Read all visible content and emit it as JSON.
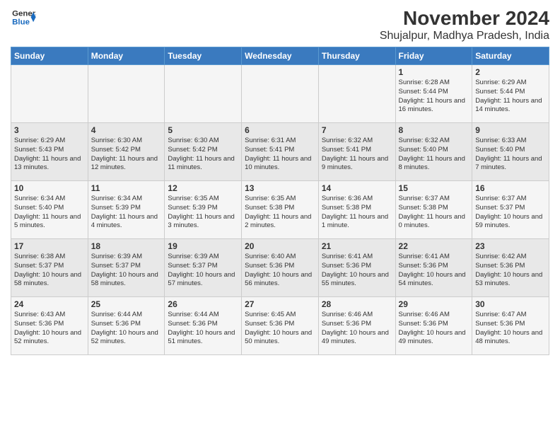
{
  "logo": {
    "line1": "General",
    "line2": "Blue"
  },
  "title": "November 2024",
  "subtitle": "Shujalpur, Madhya Pradesh, India",
  "weekdays": [
    "Sunday",
    "Monday",
    "Tuesday",
    "Wednesday",
    "Thursday",
    "Friday",
    "Saturday"
  ],
  "weeks": [
    [
      {
        "day": "",
        "info": ""
      },
      {
        "day": "",
        "info": ""
      },
      {
        "day": "",
        "info": ""
      },
      {
        "day": "",
        "info": ""
      },
      {
        "day": "",
        "info": ""
      },
      {
        "day": "1",
        "info": "Sunrise: 6:28 AM\nSunset: 5:44 PM\nDaylight: 11 hours\nand 16 minutes."
      },
      {
        "day": "2",
        "info": "Sunrise: 6:29 AM\nSunset: 5:44 PM\nDaylight: 11 hours\nand 14 minutes."
      }
    ],
    [
      {
        "day": "3",
        "info": "Sunrise: 6:29 AM\nSunset: 5:43 PM\nDaylight: 11 hours\nand 13 minutes."
      },
      {
        "day": "4",
        "info": "Sunrise: 6:30 AM\nSunset: 5:42 PM\nDaylight: 11 hours\nand 12 minutes."
      },
      {
        "day": "5",
        "info": "Sunrise: 6:30 AM\nSunset: 5:42 PM\nDaylight: 11 hours\nand 11 minutes."
      },
      {
        "day": "6",
        "info": "Sunrise: 6:31 AM\nSunset: 5:41 PM\nDaylight: 11 hours\nand 10 minutes."
      },
      {
        "day": "7",
        "info": "Sunrise: 6:32 AM\nSunset: 5:41 PM\nDaylight: 11 hours\nand 9 minutes."
      },
      {
        "day": "8",
        "info": "Sunrise: 6:32 AM\nSunset: 5:40 PM\nDaylight: 11 hours\nand 8 minutes."
      },
      {
        "day": "9",
        "info": "Sunrise: 6:33 AM\nSunset: 5:40 PM\nDaylight: 11 hours\nand 7 minutes."
      }
    ],
    [
      {
        "day": "10",
        "info": "Sunrise: 6:34 AM\nSunset: 5:40 PM\nDaylight: 11 hours\nand 5 minutes."
      },
      {
        "day": "11",
        "info": "Sunrise: 6:34 AM\nSunset: 5:39 PM\nDaylight: 11 hours\nand 4 minutes."
      },
      {
        "day": "12",
        "info": "Sunrise: 6:35 AM\nSunset: 5:39 PM\nDaylight: 11 hours\nand 3 minutes."
      },
      {
        "day": "13",
        "info": "Sunrise: 6:35 AM\nSunset: 5:38 PM\nDaylight: 11 hours\nand 2 minutes."
      },
      {
        "day": "14",
        "info": "Sunrise: 6:36 AM\nSunset: 5:38 PM\nDaylight: 11 hours\nand 1 minute."
      },
      {
        "day": "15",
        "info": "Sunrise: 6:37 AM\nSunset: 5:38 PM\nDaylight: 11 hours\nand 0 minutes."
      },
      {
        "day": "16",
        "info": "Sunrise: 6:37 AM\nSunset: 5:37 PM\nDaylight: 10 hours\nand 59 minutes."
      }
    ],
    [
      {
        "day": "17",
        "info": "Sunrise: 6:38 AM\nSunset: 5:37 PM\nDaylight: 10 hours\nand 58 minutes."
      },
      {
        "day": "18",
        "info": "Sunrise: 6:39 AM\nSunset: 5:37 PM\nDaylight: 10 hours\nand 58 minutes."
      },
      {
        "day": "19",
        "info": "Sunrise: 6:39 AM\nSunset: 5:37 PM\nDaylight: 10 hours\nand 57 minutes."
      },
      {
        "day": "20",
        "info": "Sunrise: 6:40 AM\nSunset: 5:36 PM\nDaylight: 10 hours\nand 56 minutes."
      },
      {
        "day": "21",
        "info": "Sunrise: 6:41 AM\nSunset: 5:36 PM\nDaylight: 10 hours\nand 55 minutes."
      },
      {
        "day": "22",
        "info": "Sunrise: 6:41 AM\nSunset: 5:36 PM\nDaylight: 10 hours\nand 54 minutes."
      },
      {
        "day": "23",
        "info": "Sunrise: 6:42 AM\nSunset: 5:36 PM\nDaylight: 10 hours\nand 53 minutes."
      }
    ],
    [
      {
        "day": "24",
        "info": "Sunrise: 6:43 AM\nSunset: 5:36 PM\nDaylight: 10 hours\nand 52 minutes."
      },
      {
        "day": "25",
        "info": "Sunrise: 6:44 AM\nSunset: 5:36 PM\nDaylight: 10 hours\nand 52 minutes."
      },
      {
        "day": "26",
        "info": "Sunrise: 6:44 AM\nSunset: 5:36 PM\nDaylight: 10 hours\nand 51 minutes."
      },
      {
        "day": "27",
        "info": "Sunrise: 6:45 AM\nSunset: 5:36 PM\nDaylight: 10 hours\nand 50 minutes."
      },
      {
        "day": "28",
        "info": "Sunrise: 6:46 AM\nSunset: 5:36 PM\nDaylight: 10 hours\nand 49 minutes."
      },
      {
        "day": "29",
        "info": "Sunrise: 6:46 AM\nSunset: 5:36 PM\nDaylight: 10 hours\nand 49 minutes."
      },
      {
        "day": "30",
        "info": "Sunrise: 6:47 AM\nSunset: 5:36 PM\nDaylight: 10 hours\nand 48 minutes."
      }
    ]
  ]
}
